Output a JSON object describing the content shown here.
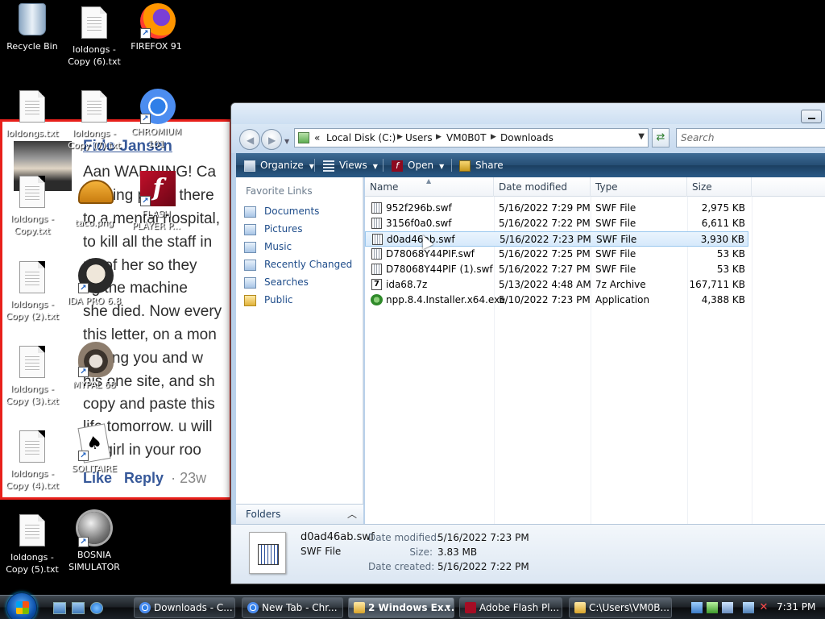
{
  "desktop": {
    "icons": [
      {
        "label": "Recycle Bin"
      },
      {
        "label": "loldongs -\nCopy (6).txt"
      },
      {
        "label": "FIREFOX 91"
      },
      {
        "label": "loldongs.txt"
      },
      {
        "label": "loldongs -\nCopy (7).txt"
      },
      {
        "label": "CHROMIUM\n101"
      },
      {
        "label": "loldongs -\nCopy.txt"
      },
      {
        "label": "taco.png"
      },
      {
        "label": "FLASH\nPLAYER P..."
      },
      {
        "label": "loldongs -\nCopy (2).txt"
      },
      {
        "label": "IDA PRO 6.8"
      },
      {
        "label": "loldongs -\nCopy (3).txt"
      },
      {
        "label": "MYPAL 68"
      },
      {
        "label": "loldongs -\nCopy (4).txt"
      },
      {
        "label": "SOLITAIRE"
      },
      {
        "label": "loldongs -\nCopy (5).txt"
      },
      {
        "label": "BOSNIA\nSIMULATOR"
      }
    ]
  },
  "overlay": {
    "name": "Fido Jansen",
    "lines": [
      "Aan WARNING! Ca",
      "naming pe ce there",
      "to a mental hospital,",
      "to kill all the staff in",
      "rid of her so they",
      "ng the machine",
      "she died. Now every",
      "this letter, on a mon",
      "putting you and w",
      "his one site, and sh",
      "copy and paste this",
      "life tomorrow. u will",
      "ad girl in your roo"
    ],
    "like": "Like",
    "reply": "Reply",
    "time": "23w"
  },
  "explorer": {
    "address": {
      "overflow": "«",
      "crumbs": [
        "Local Disk (C:)",
        "Users",
        "VM0B0T",
        "Downloads"
      ]
    },
    "search_placeholder": "Search",
    "toolbar": {
      "organize": "Organize",
      "views": "Views",
      "open": "Open",
      "share": "Share"
    },
    "nav": {
      "heading": "Favorite Links",
      "items": [
        "Documents",
        "Pictures",
        "Music",
        "Recently Changed",
        "Searches",
        "Public"
      ],
      "folders": "Folders"
    },
    "columns": [
      "Name",
      "Date modified",
      "Type",
      "Size"
    ],
    "files": [
      {
        "name": "952f296b.swf",
        "date": "5/16/2022 7:29 PM",
        "type": "SWF File",
        "size": "2,975 KB",
        "icon": "swf-file-icon"
      },
      {
        "name": "3156f0a0.swf",
        "date": "5/16/2022 7:22 PM",
        "type": "SWF File",
        "size": "6,611 KB",
        "icon": "swf-file-icon"
      },
      {
        "name": "d0ad46ab.swf",
        "date": "5/16/2022 7:23 PM",
        "type": "SWF File",
        "size": "3,930 KB",
        "icon": "swf-file-icon",
        "selected": true
      },
      {
        "name": "D78068Y44PIF.swf",
        "date": "5/16/2022 7:25 PM",
        "type": "SWF File",
        "size": "53 KB",
        "icon": "swf-file-icon"
      },
      {
        "name": "D78068Y44PIF (1).swf",
        "date": "5/16/2022 7:27 PM",
        "type": "SWF File",
        "size": "53 KB",
        "icon": "swf-file-icon"
      },
      {
        "name": "ida68.7z",
        "date": "5/13/2022 4:48 AM",
        "type": "7z Archive",
        "size": "167,711 KB",
        "icon": "7z-archive-icon"
      },
      {
        "name": "npp.8.4.Installer.x64.exe",
        "date": "5/10/2022 7:23 PM",
        "type": "Application",
        "size": "4,388 KB",
        "icon": "installer-icon"
      }
    ],
    "details": {
      "filename": "d0ad46ab.swf",
      "filetype": "SWF File",
      "modified_label": "Date modified:",
      "modified": "5/16/2022 7:23 PM",
      "size_label": "Size:",
      "size": "3.83 MB",
      "created_label": "Date created:",
      "created": "5/16/2022 7:22 PM"
    }
  },
  "taskbar": {
    "tasks": [
      {
        "label": "Downloads - C...",
        "icon": "chrome-icon"
      },
      {
        "label": "New Tab - Chr...",
        "icon": "chrome-icon"
      },
      {
        "label": "2 Windows Ex...",
        "icon": "folder-icon",
        "active": true
      },
      {
        "label": "Adobe Flash Pl...",
        "icon": "flash-icon"
      },
      {
        "label": "C:\\Users\\VM0B...",
        "icon": "folder-icon"
      }
    ],
    "clock": "7:31 PM"
  }
}
